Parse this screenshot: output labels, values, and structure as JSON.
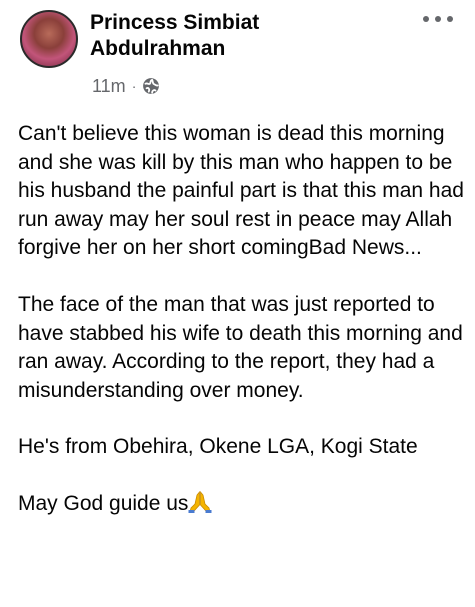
{
  "post": {
    "author_name": "Princess Simbiat Abdulrahman",
    "timestamp": "11m",
    "separator": "·",
    "privacy_icon": "globe-icon",
    "more_icon": "more-options-icon",
    "paragraphs": [
      "Can't believe this woman is dead this morning and she was kill by this man who happen to be his husband the painful part is that this man had run away may her soul rest in peace may Allah forgive her on her short comingBad News...",
      "The face of the man that was just reported to have stabbed his wife to death this morning and ran away. According to the report, they had a misunderstanding over money.",
      "He's from Obehira, Okene LGA, Kogi State"
    ],
    "closing_text": "May God guide us",
    "closing_emoji": "praying-hands-icon"
  },
  "colors": {
    "text_primary": "#050505",
    "text_secondary": "#65676b",
    "background": "#ffffff",
    "emoji": "#f4b400"
  }
}
